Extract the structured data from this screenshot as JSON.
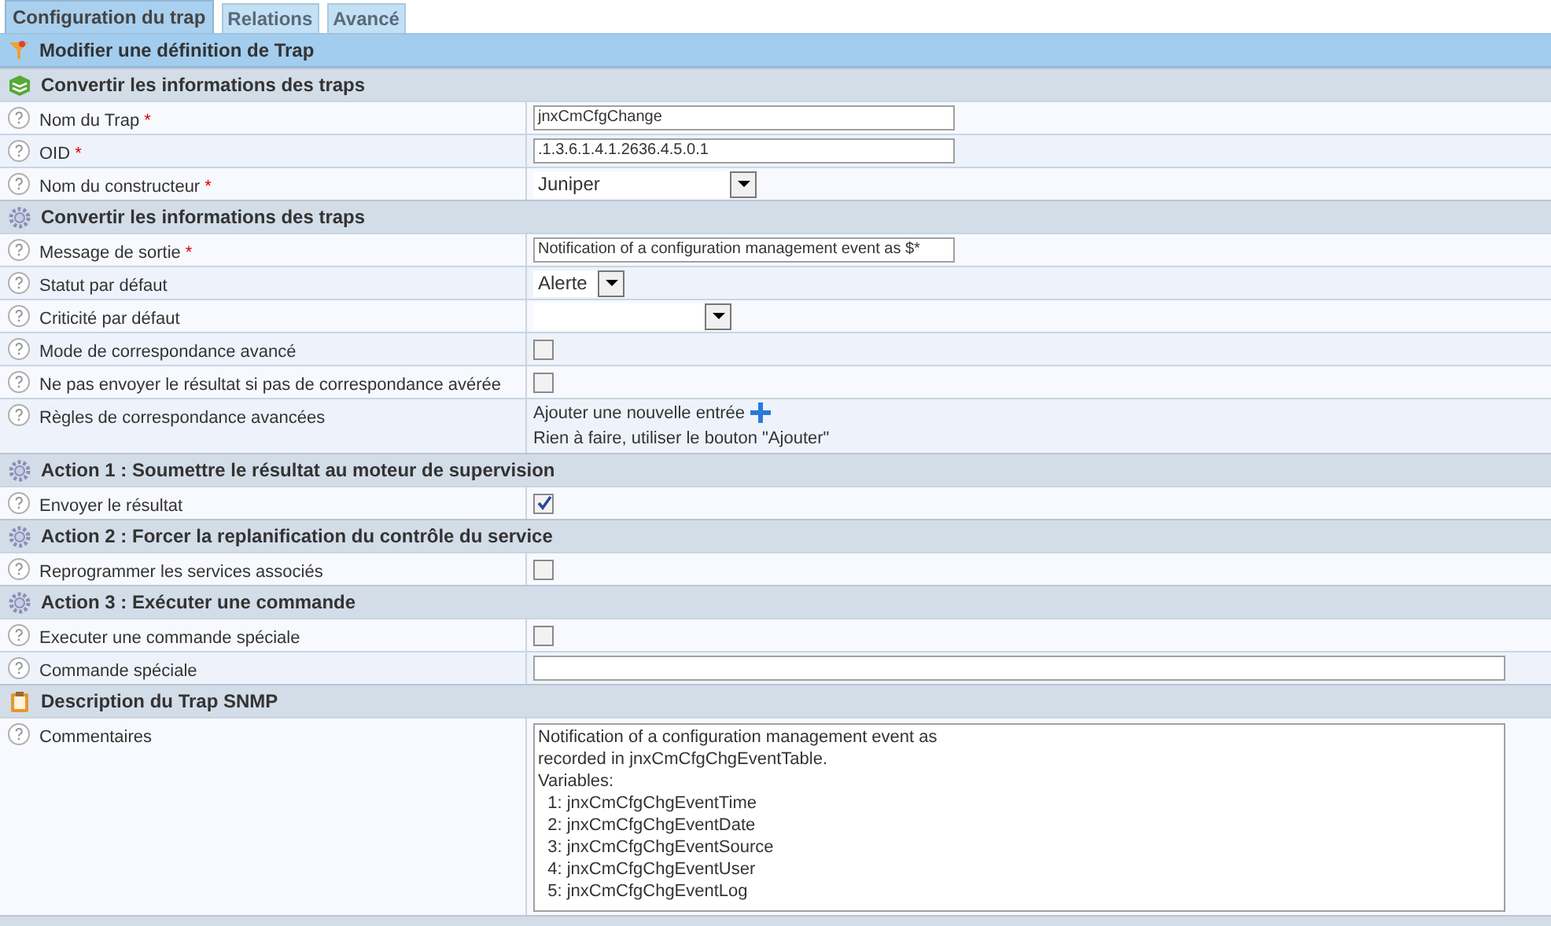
{
  "tabs": [
    {
      "label": "Configuration du trap",
      "selected": true
    },
    {
      "label": "Relations",
      "selected": false
    },
    {
      "label": "Avancé",
      "selected": false
    }
  ],
  "page_title": "Modifier une définition de Trap",
  "sections": [
    {
      "title": "Convertir les informations des traps",
      "rows": [
        {
          "kind": "text",
          "label": "Nom du Trap",
          "required_mark": "*",
          "value": "jnxCmCfgChange"
        },
        {
          "kind": "text",
          "label": "OID",
          "required_mark": "*",
          "value": ".1.3.6.1.4.1.2636.4.5.0.1"
        },
        {
          "kind": "select",
          "label": "Nom du constructeur",
          "required_mark": "*",
          "value": "Juniper"
        }
      ]
    },
    {
      "title": "Convertir les informations des traps",
      "rows": [
        {
          "kind": "text",
          "label": "Message de sortie",
          "required_mark": "*",
          "value": "Notification of a configuration management event as $*"
        },
        {
          "kind": "select",
          "label": "Statut par défaut",
          "value": "Alerte"
        },
        {
          "kind": "select",
          "label": "Criticité par défaut"
        },
        {
          "kind": "checkbox",
          "label": "Mode de correspondance avancé",
          "checked": false
        },
        {
          "kind": "checkbox",
          "label": "Ne pas envoyer le résultat si pas de correspondance avérée",
          "checked": false
        },
        {
          "kind": "rules",
          "label": "Règles de correspondance avancées",
          "link": "Ajouter une nouvelle entrée",
          "note": "Rien à faire, utiliser le bouton \"Ajouter\""
        }
      ]
    },
    {
      "title": "Action 1 : Soumettre le résultat au moteur de supervision",
      "rows": [
        {
          "kind": "checkbox",
          "label": "Envoyer le résultat",
          "checked": true
        }
      ]
    },
    {
      "title": "Action 2 : Forcer la replanification du contrôle du service",
      "rows": [
        {
          "kind": "checkbox",
          "label": "Reprogrammer les services associés",
          "checked": false
        }
      ]
    },
    {
      "title": "Action 3 : Exécuter une commande",
      "rows": [
        {
          "kind": "checkbox",
          "label": "Executer une commande spéciale",
          "checked": false
        },
        {
          "kind": "text",
          "label": "Commande spéciale"
        }
      ]
    },
    {
      "title": "Description du Trap SNMP",
      "rows": [
        {
          "kind": "textarea",
          "label": "Commentaires",
          "value": "Notification of a configuration management event as\nrecorded in jnxCmCfgChgEventTable.\nVariables:\n  1: jnxCmCfgChgEventTime\n  2: jnxCmCfgChgEventDate\n  3: jnxCmCfgChgEventSource\n  4: jnxCmCfgChgEventUser\n  5: jnxCmCfgChgEventLog"
        }
      ]
    }
  ]
}
